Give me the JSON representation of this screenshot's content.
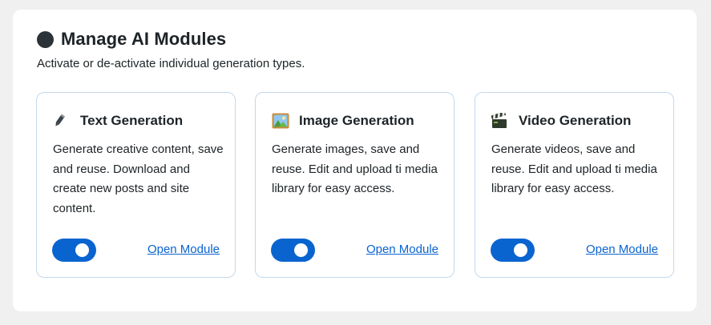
{
  "header": {
    "title": "Manage AI Modules",
    "subtitle": "Activate or de-activate individual generation types."
  },
  "modules": [
    {
      "icon": "pencil-icon",
      "title": "Text Generation",
      "description": "Generate creative content, save and reuse. Download and create new posts and site content.",
      "enabled": true,
      "link_label": "Open Module"
    },
    {
      "icon": "image-icon",
      "title": "Image Generation",
      "description": "Generate images, save and reuse. Edit and upload ti media library for easy access.",
      "enabled": true,
      "link_label": "Open Module"
    },
    {
      "icon": "clapperboard-icon",
      "title": "Video Generation",
      "description": "Generate videos, save and reuse. Edit and upload ti media library for easy access.",
      "enabled": true,
      "link_label": "Open Module"
    }
  ],
  "colors": {
    "accent": "#0a64d0",
    "card_border": "#c3d9ec",
    "background": "#f0f0f1"
  }
}
